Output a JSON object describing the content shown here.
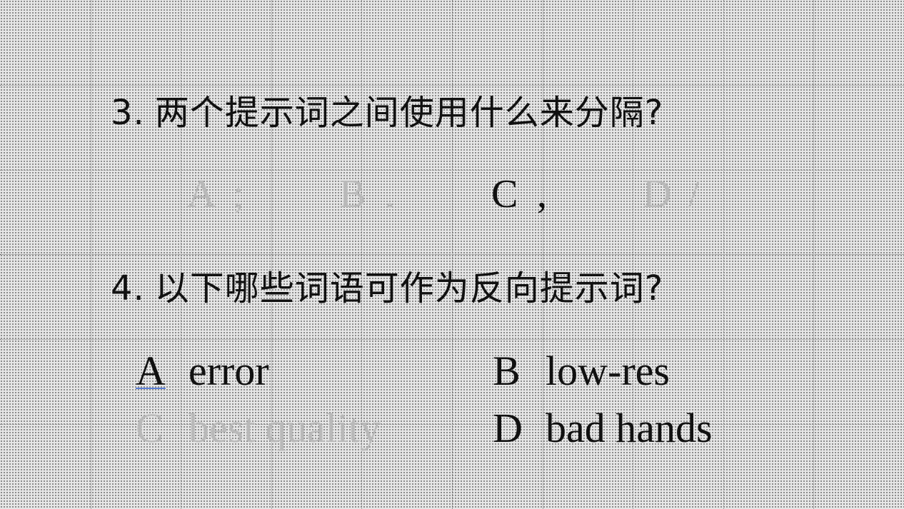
{
  "q3": {
    "number": "3.",
    "text": "两个提示词之间使用什么来分隔?",
    "options": [
      {
        "letter": "A",
        "value": ";",
        "state": "dimmed"
      },
      {
        "letter": "B",
        "value": ".",
        "state": "dimmed"
      },
      {
        "letter": "C",
        "value": ",",
        "state": "highlighted"
      },
      {
        "letter": "D",
        "value": "/",
        "state": "dimmed"
      }
    ]
  },
  "q4": {
    "number": "4.",
    "text": "以下哪些词语可作为反向提示词?",
    "options": [
      {
        "letter": "A",
        "value": "error",
        "state": "highlighted"
      },
      {
        "letter": "B",
        "value": "low-res",
        "state": "highlighted"
      },
      {
        "letter": "C",
        "value": "best quality",
        "state": "dimmed"
      },
      {
        "letter": "D",
        "value": "bad hands",
        "state": "highlighted"
      }
    ]
  },
  "colors": {
    "background": "#e6e6e6",
    "text": "#111111",
    "dimmed": "#b9b9b9",
    "underline": "#5b7fd6"
  }
}
